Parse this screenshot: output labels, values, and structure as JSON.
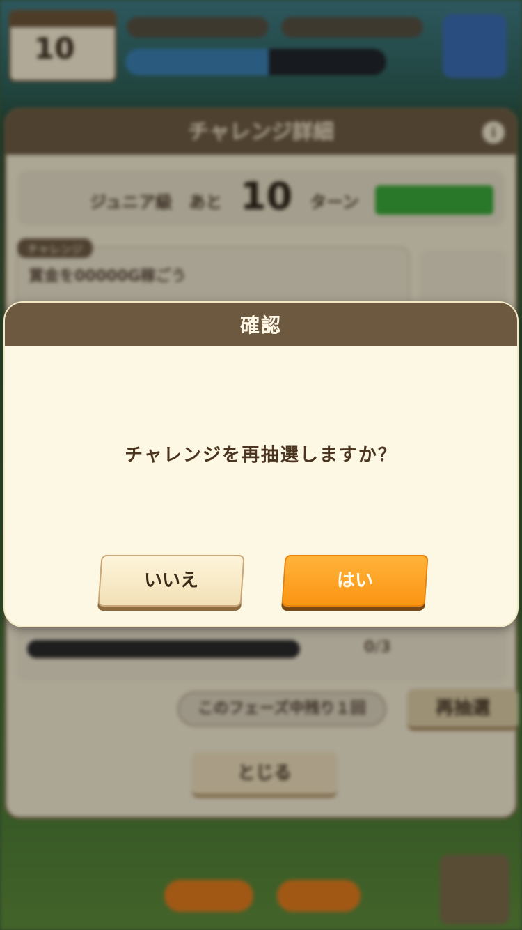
{
  "background": {
    "hud": {
      "turn_number": "10"
    },
    "panel": {
      "title": "チャレンジ詳細",
      "info_icon": "i",
      "rank_label": "ジュニア級　あと",
      "turns_left": "10",
      "turn_unit": "ターン",
      "challenge_tag": "チャレンジ",
      "challenge_text": "賞金を00000G稼ごう",
      "progress_count": "0/3",
      "remaining_text": "このフェーズ中残り１回",
      "redraw_label": "再抽選",
      "close_label": "とじる"
    }
  },
  "dialog": {
    "title": "確認",
    "message": "チャレンジを再抽選しますか？",
    "no_label": "いいえ",
    "yes_label": "はい"
  },
  "colors": {
    "dialog_header": "#6c5940",
    "dialog_body": "#fdf8e3",
    "yes_button": "#fb9413",
    "no_button": "#f3e1b6",
    "text_dark": "#4b3520"
  },
  "icons": {
    "info": "info-icon"
  }
}
